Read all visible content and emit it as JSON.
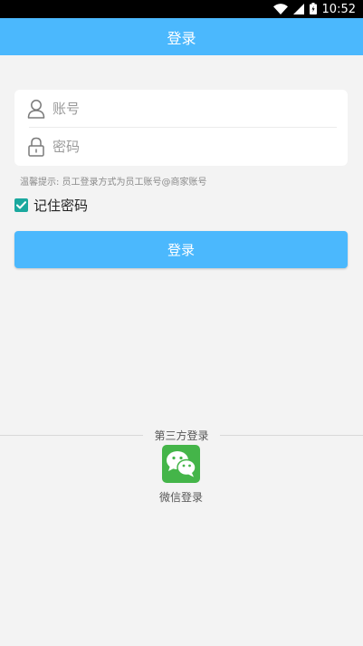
{
  "status_bar": {
    "time": "10:52"
  },
  "header": {
    "title": "登录"
  },
  "form": {
    "account": {
      "placeholder": "账号",
      "value": ""
    },
    "password": {
      "placeholder": "密码",
      "value": ""
    },
    "hint": "温馨提示: 员工登录方式为员工账号@商家账号",
    "remember": {
      "label": "记住密码",
      "checked": true
    },
    "login_button": "登录"
  },
  "third_party": {
    "title": "第三方登录",
    "wechat": {
      "label": "微信登录",
      "icon": "wechat-icon"
    }
  },
  "colors": {
    "primary": "#4bb8fd",
    "checkbox": "#1aa89e",
    "wechat": "#44b549"
  }
}
